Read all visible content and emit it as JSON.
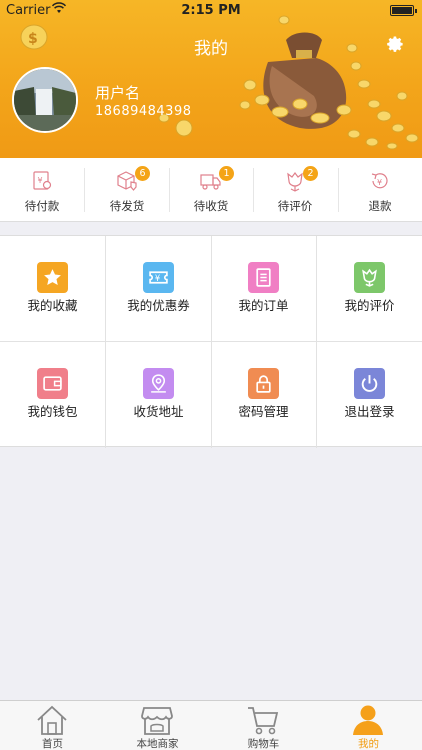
{
  "status_bar": {
    "carrier": "Carrier",
    "time": "2:15 PM"
  },
  "header": {
    "title": "我的",
    "username": "用户名",
    "phone": "18689484398"
  },
  "orders": [
    {
      "label": "待付款",
      "icon": "wallet-yen-icon",
      "badge": ""
    },
    {
      "label": "待发货",
      "icon": "box-shield-icon",
      "badge": "6"
    },
    {
      "label": "待收货",
      "icon": "truck-icon",
      "badge": "1"
    },
    {
      "label": "待评价",
      "icon": "flower-icon",
      "badge": "2"
    },
    {
      "label": "退款",
      "icon": "refund-yen-icon",
      "badge": ""
    }
  ],
  "menu": [
    {
      "label": "我的收藏",
      "icon": "star-icon",
      "color": "#f5a623"
    },
    {
      "label": "我的优惠券",
      "icon": "ticket-icon",
      "color": "#5ab7f0"
    },
    {
      "label": "我的订单",
      "icon": "list-icon",
      "color": "#f07fc4"
    },
    {
      "label": "我的评价",
      "icon": "flower-icon",
      "color": "#7dc76a"
    },
    {
      "label": "我的钱包",
      "icon": "wallet-icon",
      "color": "#f07f8a"
    },
    {
      "label": "收货地址",
      "icon": "map-pin-icon",
      "color": "#c38cf0"
    },
    {
      "label": "密码管理",
      "icon": "lock-icon",
      "color": "#f08c52"
    },
    {
      "label": "退出登录",
      "icon": "power-icon",
      "color": "#7b86d8"
    }
  ],
  "tabs": [
    {
      "label": "首页",
      "icon": "home-icon",
      "active": false
    },
    {
      "label": "本地商家",
      "icon": "store-icon",
      "active": false
    },
    {
      "label": "购物车",
      "icon": "cart-icon",
      "active": false
    },
    {
      "label": "我的",
      "icon": "user-icon",
      "active": true
    }
  ],
  "colors": {
    "header": "#f3a51a",
    "badge": "#f4a417",
    "active_tab": "#f19d12"
  }
}
